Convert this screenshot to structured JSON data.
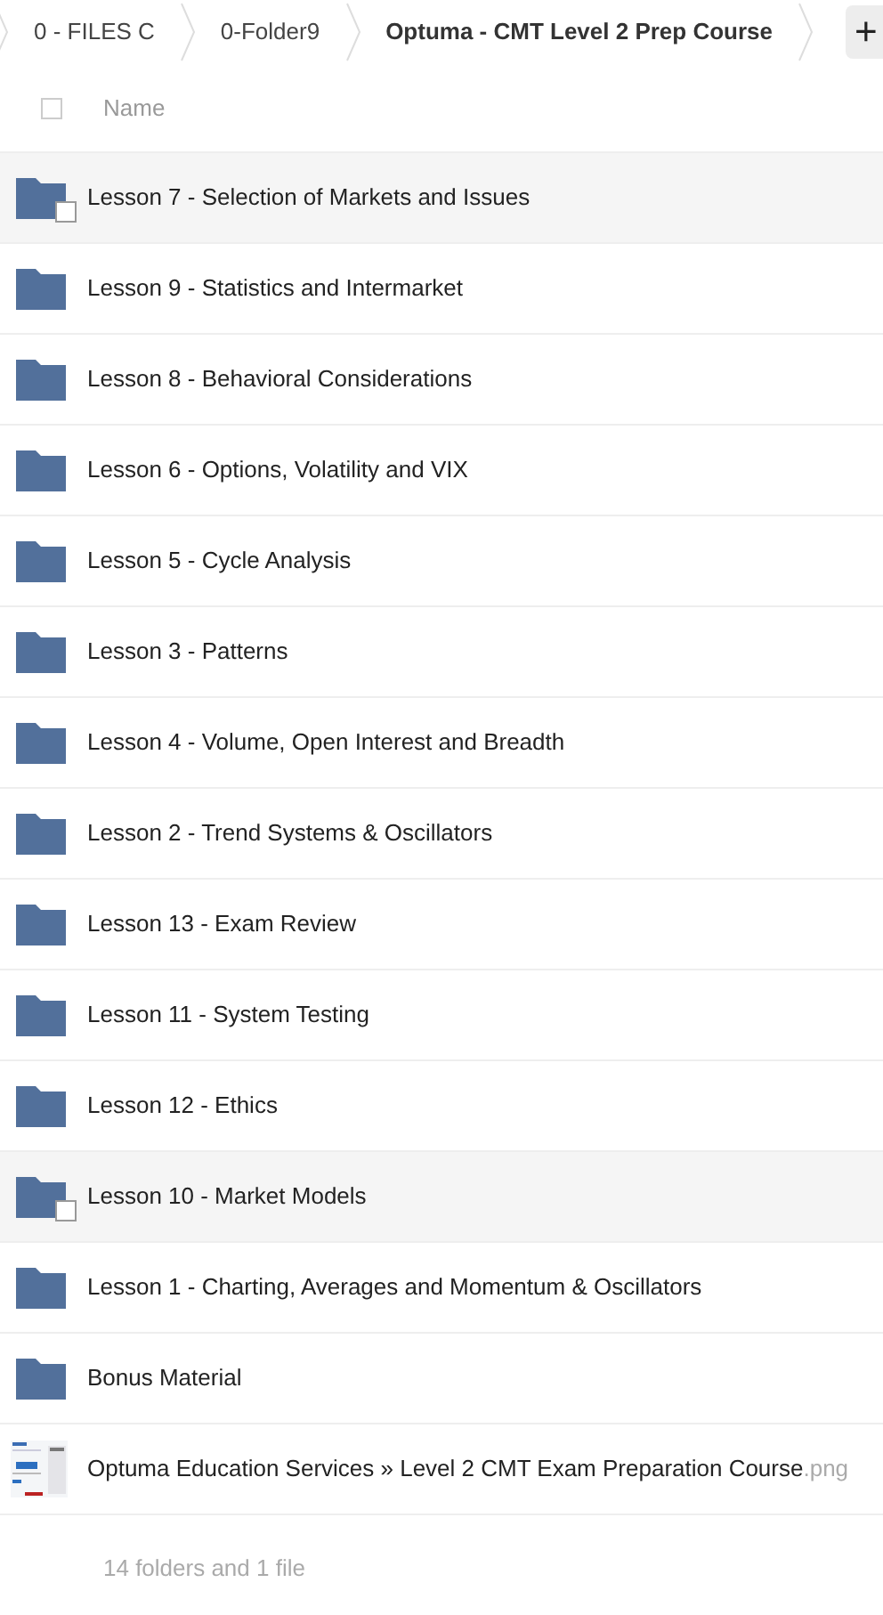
{
  "breadcrumb": [
    {
      "label": "0 - FILES C",
      "current": false
    },
    {
      "label": "0-Folder9",
      "current": false
    },
    {
      "label": "Optuma - CMT Level 2 Prep Course",
      "current": true
    }
  ],
  "new_button": {
    "label": "+"
  },
  "header": {
    "select_all_checked": false,
    "column": "Name"
  },
  "items": [
    {
      "kind": "folder",
      "name": "Lesson 7 - Selection of Markets and Issues",
      "highlighted": true
    },
    {
      "kind": "folder",
      "name": "Lesson 9 - Statistics and Intermarket",
      "highlighted": false
    },
    {
      "kind": "folder",
      "name": "Lesson 8 - Behavioral Considerations",
      "highlighted": false
    },
    {
      "kind": "folder",
      "name": "Lesson 6 - Options, Volatility and VIX",
      "highlighted": false
    },
    {
      "kind": "folder",
      "name": "Lesson 5 - Cycle Analysis",
      "highlighted": false
    },
    {
      "kind": "folder",
      "name": "Lesson 3 - Patterns",
      "highlighted": false
    },
    {
      "kind": "folder",
      "name": "Lesson 4 - Volume, Open Interest and Breadth",
      "highlighted": false
    },
    {
      "kind": "folder",
      "name": "Lesson 2 - Trend Systems & Oscillators",
      "highlighted": false
    },
    {
      "kind": "folder",
      "name": "Lesson 13 - Exam Review",
      "highlighted": false
    },
    {
      "kind": "folder",
      "name": "Lesson 11 - System Testing",
      "highlighted": false
    },
    {
      "kind": "folder",
      "name": "Lesson 12 - Ethics",
      "highlighted": false
    },
    {
      "kind": "folder",
      "name": "Lesson 10 - Market Models",
      "highlighted": true
    },
    {
      "kind": "folder",
      "name": "Lesson 1 - Charting, Averages and Momentum & Oscillators",
      "highlighted": false
    },
    {
      "kind": "folder",
      "name": "Bonus Material",
      "highlighted": false
    },
    {
      "kind": "file",
      "name": "Optuma Education Services » Level 2 CMT Exam Preparation Course",
      "extension": ".png",
      "highlighted": false
    }
  ],
  "summary": "14 folders and 1 file"
}
